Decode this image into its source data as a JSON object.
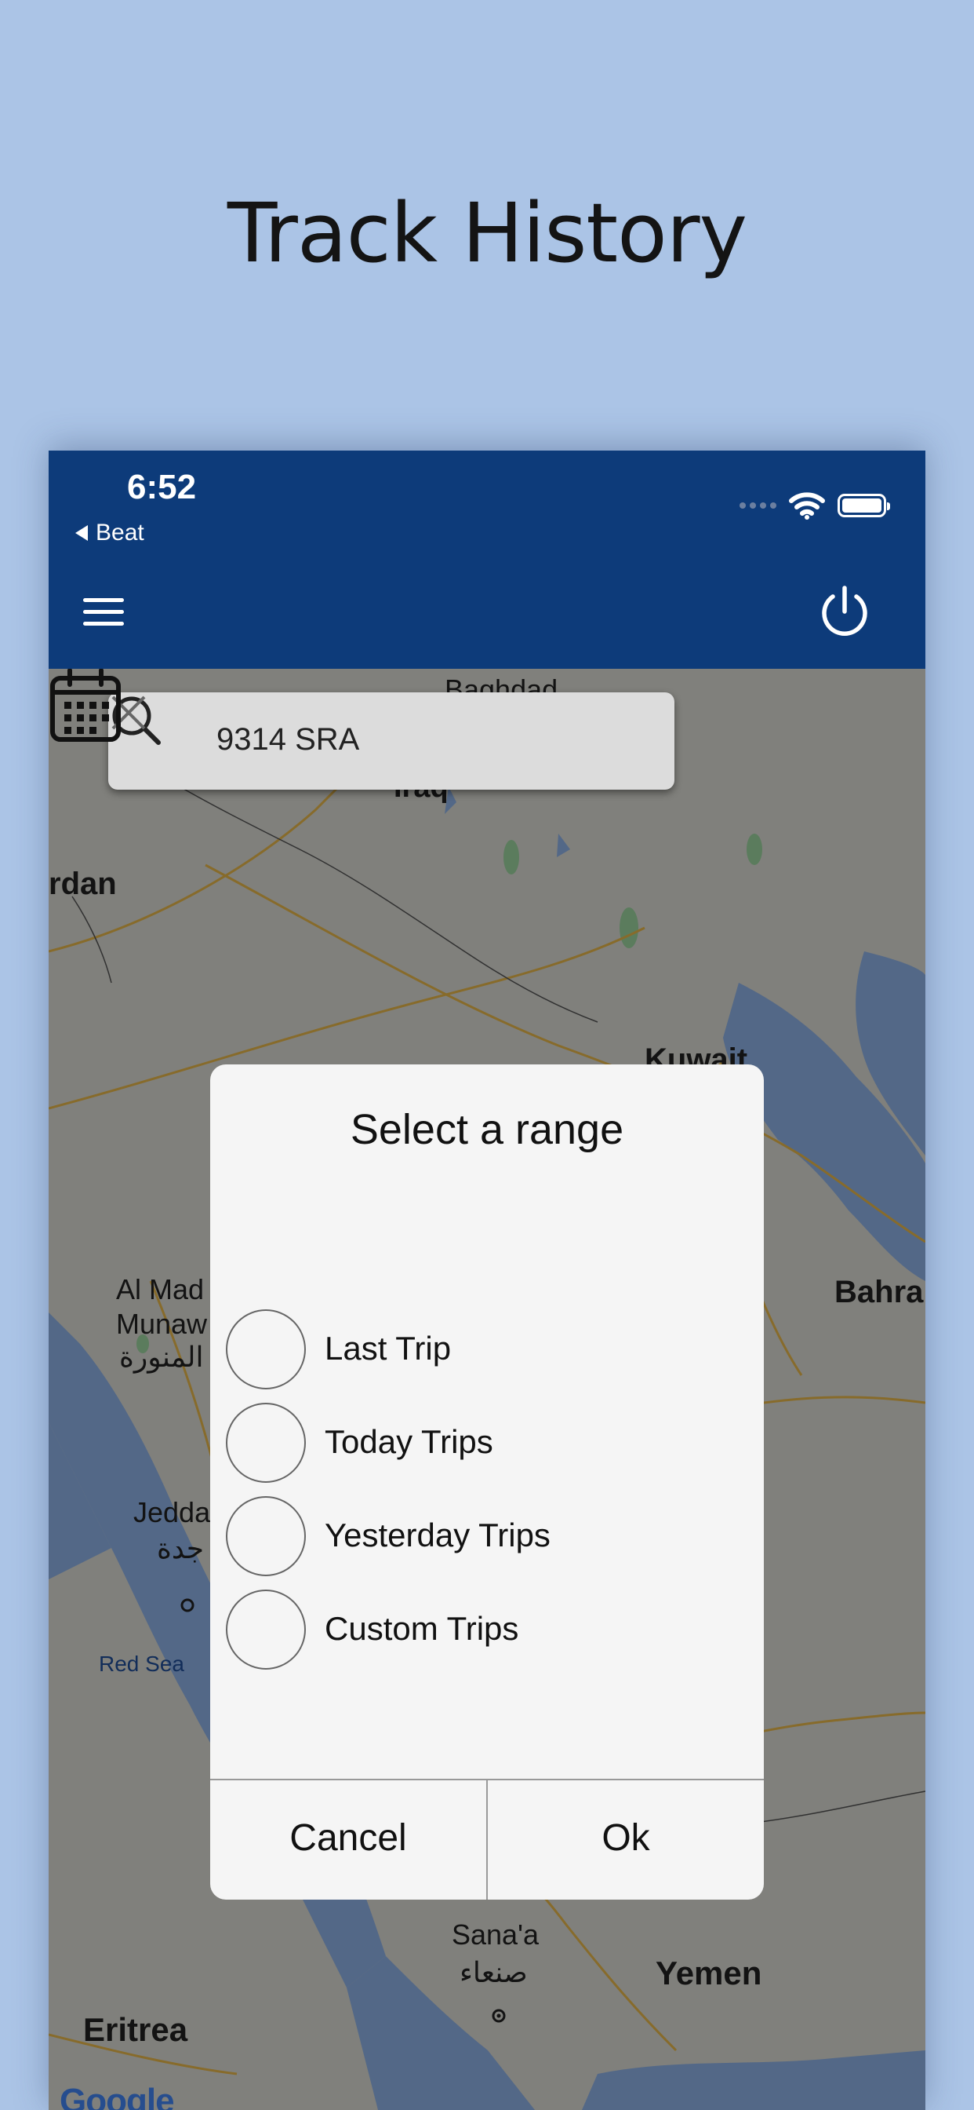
{
  "promo": {
    "headline": "Track History"
  },
  "status_bar": {
    "time": "6:52",
    "back_app": "Beat"
  },
  "search": {
    "value": "9314 SRA"
  },
  "map": {
    "labels": {
      "iraq": "Iraq",
      "jordan": "rdan",
      "kuwait": "Kuwait",
      "bahrain": "Bahra",
      "medina_1": "Al Mad",
      "medina_2": "Munaw",
      "medina_ar": "المنورة",
      "jeddah": "Jedda",
      "jeddah_ar": "جدة",
      "red_sea": "Red Sea",
      "sanaa": "Sana'a",
      "sanaa_ar": "صنعاء",
      "yemen": "Yemen",
      "eritrea": "Eritrea",
      "baghdad_partial": "Baghdad"
    },
    "attribution": "Google",
    "colors": {
      "land": "#dcdcd6",
      "water": "#8fb3e8",
      "roads": "#e9b84a",
      "vegetation": "#9dd6a0"
    }
  },
  "dialog": {
    "title": "Select a range",
    "options": [
      {
        "label": "Last Trip",
        "selected": false
      },
      {
        "label": "Today Trips",
        "selected": false
      },
      {
        "label": "Yesterday Trips",
        "selected": false
      },
      {
        "label": "Custom Trips",
        "selected": false
      }
    ],
    "cancel_label": "Cancel",
    "ok_label": "Ok"
  },
  "colors": {
    "background": "#abc4e6",
    "app_bar": "#0d3b7a",
    "dialog_bg": "#f5f5f5"
  },
  "icons": {
    "menu": "hamburger-menu-icon",
    "power": "power-icon",
    "search": "search-icon",
    "clear": "close-icon",
    "calendar": "calendar-icon"
  }
}
